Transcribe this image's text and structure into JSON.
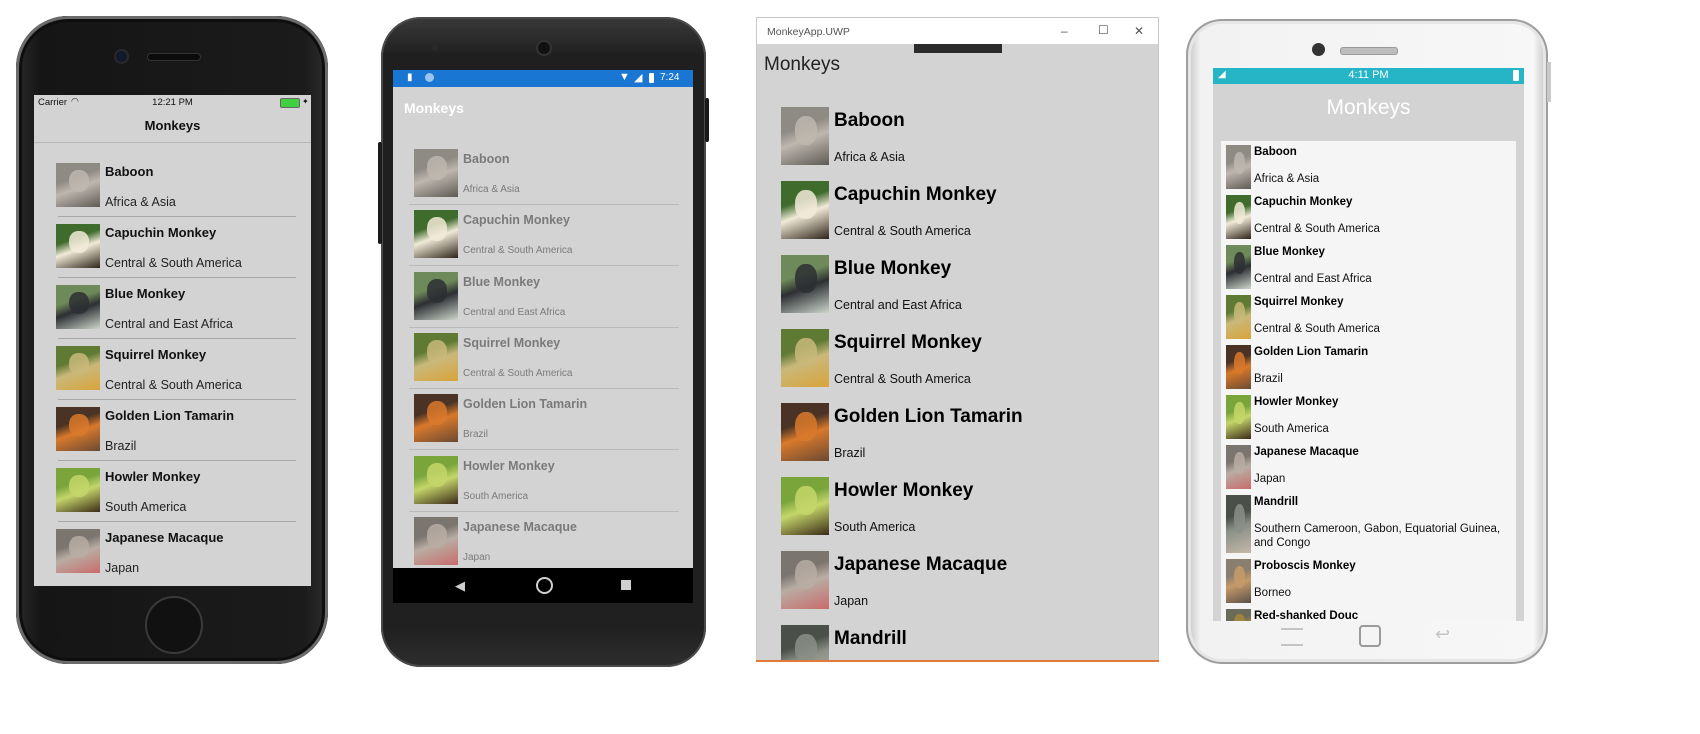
{
  "monkeys": [
    {
      "name": "Baboon",
      "location": "Africa & Asia",
      "colors": [
        "#8e8a84",
        "#bdb7ae",
        "#5e5a55"
      ]
    },
    {
      "name": "Capuchin Monkey",
      "location": "Central & South America",
      "colors": [
        "#3f6b2d",
        "#f2ead8",
        "#2b2418"
      ]
    },
    {
      "name": "Blue Monkey",
      "location": "Central and East Africa",
      "colors": [
        "#6f8a5a",
        "#2d2f33",
        "#cdd6cc"
      ]
    },
    {
      "name": "Squirrel Monkey",
      "location": "Central & South America",
      "colors": [
        "#5e7a33",
        "#c9b87a",
        "#d9a43a"
      ]
    },
    {
      "name": "Golden Lion Tamarin",
      "location": "Brazil",
      "colors": [
        "#4a3325",
        "#d9792b",
        "#6b4a33"
      ]
    },
    {
      "name": "Howler Monkey",
      "location": "South America",
      "colors": [
        "#7aa53b",
        "#c4d66a",
        "#3b2a18"
      ]
    },
    {
      "name": "Japanese Macaque",
      "location": "Japan",
      "colors": [
        "#7b756f",
        "#b8ada3",
        "#c96b6b"
      ]
    },
    {
      "name": "Mandrill",
      "location": "Southern Cameroon, Gabon, Equatorial Guinea, and Congo",
      "colors": [
        "#4a4f4a",
        "#8a8f86",
        "#c4b8a8"
      ]
    },
    {
      "name": "Proboscis Monkey",
      "location": "Borneo",
      "colors": [
        "#8a7e6e",
        "#c59a6a",
        "#5a5048"
      ]
    },
    {
      "name": "Red-shanked Douc",
      "location": "",
      "colors": [
        "#6b6b5a",
        "#a8883a",
        "#40403a"
      ]
    }
  ],
  "ios": {
    "carrier": "Carrier",
    "time": "12:21 PM",
    "title": "Monkeys"
  },
  "android": {
    "time": "7:24",
    "title": "Monkeys"
  },
  "uwp": {
    "window_title": "MonkeyApp.UWP",
    "heading": "Monkeys",
    "minimize": "–",
    "maximize": "☐",
    "close": "✕"
  },
  "tizen": {
    "time": "4:11 PM",
    "title": "Monkeys"
  }
}
